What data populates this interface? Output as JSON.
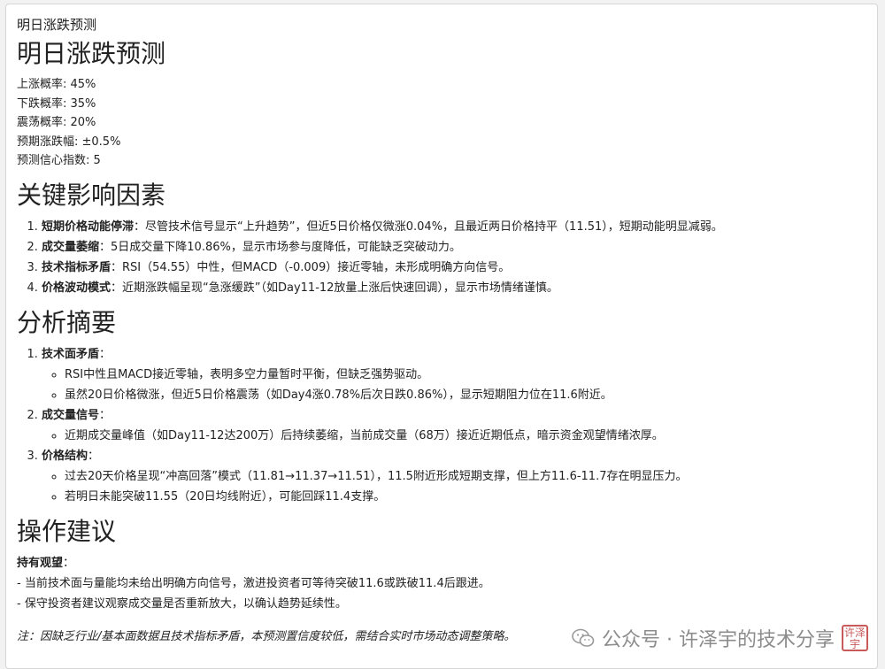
{
  "page_title": "明日涨跌预测",
  "heading": "明日涨跌预测",
  "stats": [
    "上涨概率: 45%",
    "下跌概率: 35%",
    "震荡概率: 20%",
    "预期涨跌幅: ±0.5%",
    "预测信心指数: 5"
  ],
  "factors": {
    "heading": "关键影响因素",
    "items": [
      {
        "label": "短期价格动能停滞",
        "text": "：尽管技术信号显示“上升趋势”，但近5日价格仅微涨0.04%，且最近两日价格持平（11.51），短期动能明显减弱。"
      },
      {
        "label": "成交量萎缩",
        "text": "：5日成交量下降10.86%，显示市场参与度降低，可能缺乏突破动力。"
      },
      {
        "label": "技术指标矛盾",
        "text": "：RSI（54.55）中性，但MACD（-0.009）接近零轴，未形成明确方向信号。"
      },
      {
        "label": "价格波动模式",
        "text": "：近期涨跌幅呈现“急涨缓跌”（如Day11-12放量上涨后快速回调），显示市场情绪谨慎。"
      }
    ]
  },
  "summary": {
    "heading": "分析摘要",
    "items": [
      {
        "label": "技术面矛盾",
        "colon": "：",
        "subs": [
          "RSI中性且MACD接近零轴，表明多空力量暂时平衡，但缺乏强势驱动。",
          "虽然20日价格微涨，但近5日价格震荡（如Day4涨0.78%后次日跌0.86%），显示短期阻力位在11.6附近。"
        ]
      },
      {
        "label": "成交量信号",
        "colon": "：",
        "subs": [
          "近期成交量峰值（如Day11-12达200万）后持续萎缩，当前成交量（68万）接近近期低点，暗示资金观望情绪浓厚。"
        ]
      },
      {
        "label": "价格结构",
        "colon": "：",
        "subs": [
          "过去20天价格呈现“冲高回落”模式（11.81→11.37→11.51），11.5附近形成短期支撑，但上方11.6-11.7存在明显压力。",
          "若明日未能突破11.55（20日均线附近），可能回踩11.4支撑。"
        ]
      }
    ]
  },
  "advice": {
    "heading": "操作建议",
    "stance": "持有观望",
    "stance_colon": "：",
    "lines": [
      "- 当前技术面与量能均未给出明确方向信号，激进投资者可等待突破11.6或跌破11.4后跟进。",
      "- 保守投资者建议观察成交量是否重新放大，以确认趋势延续性。"
    ]
  },
  "note": "注：因缺乏行业/基本面数据且技术指标矛盾，本预测置信度较低，需结合实时市场动态调整策略。",
  "watermark": {
    "text": "公众号 · 许泽宇的技术分享",
    "icon": "wechat-icon",
    "seal_text": "许泽宇"
  }
}
